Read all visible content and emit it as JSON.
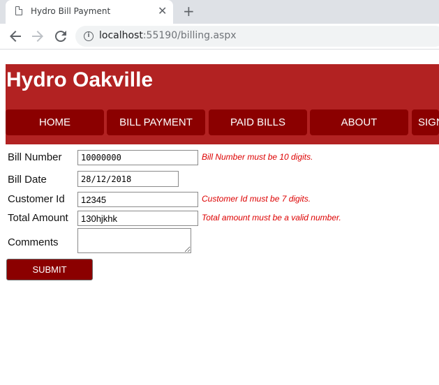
{
  "browser": {
    "tab_title": "Hydro Bill Payment",
    "tab_close": "✕",
    "new_tab": "+",
    "url_host": "localhost",
    "url_rest": ":55190/billing.aspx"
  },
  "site": {
    "title": "Hydro Oakville",
    "nav": [
      {
        "label": "HOME"
      },
      {
        "label": "BILL PAYMENT"
      },
      {
        "label": "PAID BILLS"
      },
      {
        "label": "ABOUT"
      },
      {
        "label": "SIGN"
      }
    ]
  },
  "form": {
    "bill_number": {
      "label": "Bill Number",
      "value": "10000000",
      "error": "Bill Number must be 10 digits."
    },
    "bill_date": {
      "label": "Bill Date",
      "value": "28/12/2018"
    },
    "customer_id": {
      "label": "Customer Id",
      "value": "12345",
      "error": "Customer Id must be 7 digits."
    },
    "total_amount": {
      "label": "Total Amount",
      "value": "130hjkhk",
      "error": "Total amount must be a valid number."
    },
    "comments": {
      "label": "Comments",
      "value": ""
    },
    "submit_label": "SUBMIT"
  },
  "colors": {
    "header": "#b22222",
    "nav": "#8b0000",
    "error": "#dd0000"
  }
}
